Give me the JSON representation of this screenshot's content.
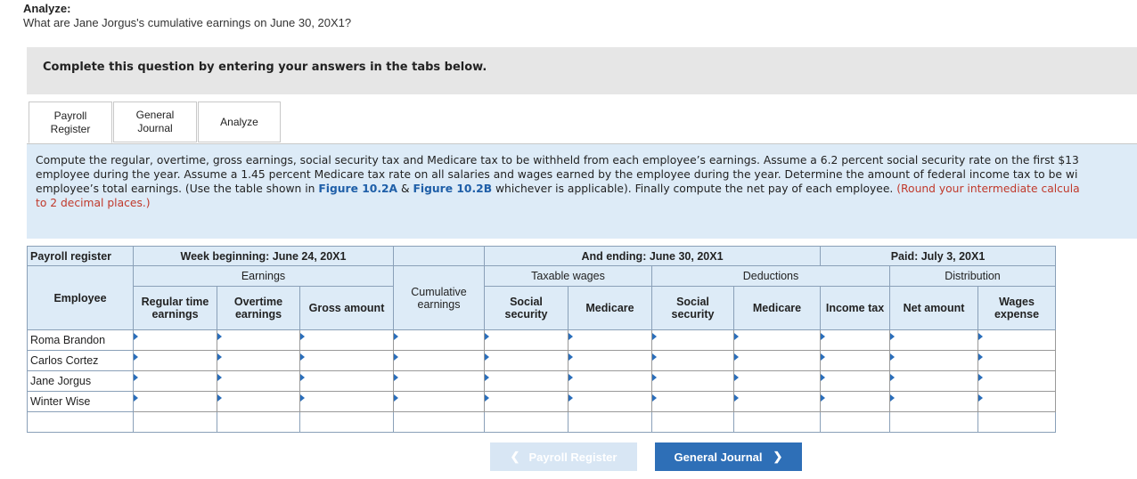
{
  "analyze": {
    "heading": "Analyze:",
    "question": "What are Jane Jorgus's cumulative earnings on June 30, 20X1?"
  },
  "instruction_bar": "Complete this question by entering your answers in the tabs below.",
  "tabs": [
    {
      "label_line1": "Payroll",
      "label_line2": "Register"
    },
    {
      "label_line1": "General",
      "label_line2": "Journal"
    },
    {
      "label_line1": "Analyze",
      "label_line2": ""
    }
  ],
  "instructions": {
    "line1": "Compute the regular, overtime, gross earnings, social security tax and Medicare tax to be withheld from each employee’s earnings. Assume a 6.2 percent social security rate on the first $13",
    "line2": "employee during the year. Assume a 1.45 percent Medicare tax rate on all salaries and wages earned by the employee during the year. Determine the amount of federal income tax to be wi",
    "line3_a": "employee’s total earnings. (Use the table shown in ",
    "fig_a": "Figure 10.2A",
    "amp": " & ",
    "fig_b": "Figure 10.2B",
    "line3_b": " whichever is applicable). Finally compute the net pay of each employee. ",
    "line3_red": "(Round your intermediate calcula",
    "line4_red": "to 2 decimal places.)"
  },
  "register": {
    "title": "Payroll register",
    "week_beginning": "Week beginning: June 24, 20X1",
    "and_ending": "And ending: June 30, 20X1",
    "paid": "Paid: July 3, 20X1",
    "earnings": "Earnings",
    "taxable_wages": "Taxable wages",
    "deductions": "Deductions",
    "distribution": "Distribution",
    "employee": "Employee",
    "regular_time_1": "Regular time",
    "regular_time_2": "earnings",
    "overtime_1": "Overtime",
    "overtime_2": "earnings",
    "gross_amount": "Gross amount",
    "cumulative_1": "Cumulative",
    "cumulative_2": "earnings",
    "ss_1": "Social",
    "ss_2": "security",
    "medicare": "Medicare",
    "ded_ss_1": "Social",
    "ded_ss_2": "security",
    "ded_medicare": "Medicare",
    "income_tax": "Income tax",
    "net_amount": "Net amount",
    "wages_1": "Wages",
    "wages_2": "expense",
    "employees": [
      "Roma Brandon",
      "Carlos Cortez",
      "Jane Jorgus",
      "Winter Wise"
    ]
  },
  "buttons": {
    "prev": "Payroll Register",
    "next": "General Journal"
  }
}
